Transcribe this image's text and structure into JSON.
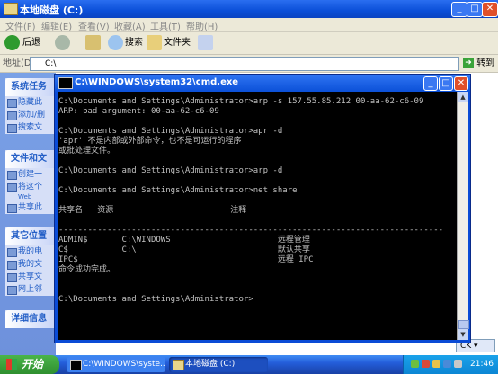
{
  "explorer": {
    "title": "本地磁盘 (C:)",
    "menu": [
      "文件(F)",
      "编辑(E)",
      "查看(V)",
      "收藏(A)",
      "工具(T)",
      "帮助(H)"
    ],
    "toolbar": {
      "back": "后退",
      "search": "搜索",
      "folders": "文件夹"
    },
    "address_label": "地址(D)",
    "address_value": "C:\\",
    "go_label": "转到",
    "left_panels": [
      {
        "title": "系统任务",
        "items": [
          "隐藏此",
          "添加/删",
          "搜索文"
        ]
      },
      {
        "title": "文件和文",
        "items": [
          "创建一",
          "将这个",
          "共享此"
        ]
      },
      {
        "title": "其它位置",
        "items": [
          "我的电",
          "我的文",
          "共享文",
          "网上邻"
        ]
      },
      {
        "title": "详细信息",
        "items": []
      }
    ],
    "left_sub_note": "Web"
  },
  "cmd": {
    "title": "C:\\WINDOWS\\system32\\cmd.exe",
    "lines": [
      "C:\\Documents and Settings\\Administrator>arp -s 157.55.85.212 00-aa-62-c6-09",
      "ARP: bad argument: 00-aa-62-c6-09",
      "",
      "C:\\Documents and Settings\\Administrator>apr -d",
      "'apr' 不是内部或外部命令，也不是可运行的程序",
      "或批处理文件。",
      "",
      "C:\\Documents and Settings\\Administrator>arp -d",
      "",
      "C:\\Documents and Settings\\Administrator>net share",
      "",
      "共享名   资源                        注释",
      "",
      "-------------------------------------------------------------------------------",
      "ADMIN$       C:\\WINDOWS                      远程管理",
      "C$           C:\\                             默认共享",
      "IPC$                                         远程 IPC",
      "命令成功完成。",
      "",
      "",
      "C:\\Documents and Settings\\Administrator>"
    ]
  },
  "ime": "CK",
  "taskbar": {
    "start": "开始",
    "tasks": [
      "C:\\WINDOWS\\syste...",
      "本地磁盘 (C:)"
    ],
    "clock": "21:46"
  }
}
